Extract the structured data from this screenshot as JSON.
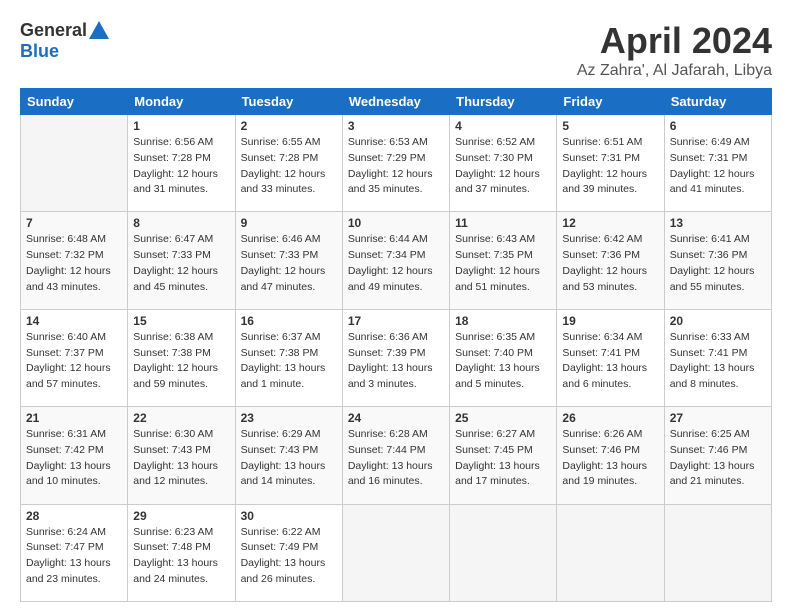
{
  "header": {
    "logo_general": "General",
    "logo_blue": "Blue",
    "title": "April 2024",
    "location": "Az Zahra', Al Jafarah, Libya"
  },
  "calendar": {
    "days_of_week": [
      "Sunday",
      "Monday",
      "Tuesday",
      "Wednesday",
      "Thursday",
      "Friday",
      "Saturday"
    ],
    "weeks": [
      [
        {
          "day": "",
          "sunrise": "",
          "sunset": "",
          "daylight": ""
        },
        {
          "day": "1",
          "sunrise": "Sunrise: 6:56 AM",
          "sunset": "Sunset: 7:28 PM",
          "daylight": "Daylight: 12 hours and 31 minutes."
        },
        {
          "day": "2",
          "sunrise": "Sunrise: 6:55 AM",
          "sunset": "Sunset: 7:28 PM",
          "daylight": "Daylight: 12 hours and 33 minutes."
        },
        {
          "day": "3",
          "sunrise": "Sunrise: 6:53 AM",
          "sunset": "Sunset: 7:29 PM",
          "daylight": "Daylight: 12 hours and 35 minutes."
        },
        {
          "day": "4",
          "sunrise": "Sunrise: 6:52 AM",
          "sunset": "Sunset: 7:30 PM",
          "daylight": "Daylight: 12 hours and 37 minutes."
        },
        {
          "day": "5",
          "sunrise": "Sunrise: 6:51 AM",
          "sunset": "Sunset: 7:31 PM",
          "daylight": "Daylight: 12 hours and 39 minutes."
        },
        {
          "day": "6",
          "sunrise": "Sunrise: 6:49 AM",
          "sunset": "Sunset: 7:31 PM",
          "daylight": "Daylight: 12 hours and 41 minutes."
        }
      ],
      [
        {
          "day": "7",
          "sunrise": "Sunrise: 6:48 AM",
          "sunset": "Sunset: 7:32 PM",
          "daylight": "Daylight: 12 hours and 43 minutes."
        },
        {
          "day": "8",
          "sunrise": "Sunrise: 6:47 AM",
          "sunset": "Sunset: 7:33 PM",
          "daylight": "Daylight: 12 hours and 45 minutes."
        },
        {
          "day": "9",
          "sunrise": "Sunrise: 6:46 AM",
          "sunset": "Sunset: 7:33 PM",
          "daylight": "Daylight: 12 hours and 47 minutes."
        },
        {
          "day": "10",
          "sunrise": "Sunrise: 6:44 AM",
          "sunset": "Sunset: 7:34 PM",
          "daylight": "Daylight: 12 hours and 49 minutes."
        },
        {
          "day": "11",
          "sunrise": "Sunrise: 6:43 AM",
          "sunset": "Sunset: 7:35 PM",
          "daylight": "Daylight: 12 hours and 51 minutes."
        },
        {
          "day": "12",
          "sunrise": "Sunrise: 6:42 AM",
          "sunset": "Sunset: 7:36 PM",
          "daylight": "Daylight: 12 hours and 53 minutes."
        },
        {
          "day": "13",
          "sunrise": "Sunrise: 6:41 AM",
          "sunset": "Sunset: 7:36 PM",
          "daylight": "Daylight: 12 hours and 55 minutes."
        }
      ],
      [
        {
          "day": "14",
          "sunrise": "Sunrise: 6:40 AM",
          "sunset": "Sunset: 7:37 PM",
          "daylight": "Daylight: 12 hours and 57 minutes."
        },
        {
          "day": "15",
          "sunrise": "Sunrise: 6:38 AM",
          "sunset": "Sunset: 7:38 PM",
          "daylight": "Daylight: 12 hours and 59 minutes."
        },
        {
          "day": "16",
          "sunrise": "Sunrise: 6:37 AM",
          "sunset": "Sunset: 7:38 PM",
          "daylight": "Daylight: 13 hours and 1 minute."
        },
        {
          "day": "17",
          "sunrise": "Sunrise: 6:36 AM",
          "sunset": "Sunset: 7:39 PM",
          "daylight": "Daylight: 13 hours and 3 minutes."
        },
        {
          "day": "18",
          "sunrise": "Sunrise: 6:35 AM",
          "sunset": "Sunset: 7:40 PM",
          "daylight": "Daylight: 13 hours and 5 minutes."
        },
        {
          "day": "19",
          "sunrise": "Sunrise: 6:34 AM",
          "sunset": "Sunset: 7:41 PM",
          "daylight": "Daylight: 13 hours and 6 minutes."
        },
        {
          "day": "20",
          "sunrise": "Sunrise: 6:33 AM",
          "sunset": "Sunset: 7:41 PM",
          "daylight": "Daylight: 13 hours and 8 minutes."
        }
      ],
      [
        {
          "day": "21",
          "sunrise": "Sunrise: 6:31 AM",
          "sunset": "Sunset: 7:42 PM",
          "daylight": "Daylight: 13 hours and 10 minutes."
        },
        {
          "day": "22",
          "sunrise": "Sunrise: 6:30 AM",
          "sunset": "Sunset: 7:43 PM",
          "daylight": "Daylight: 13 hours and 12 minutes."
        },
        {
          "day": "23",
          "sunrise": "Sunrise: 6:29 AM",
          "sunset": "Sunset: 7:43 PM",
          "daylight": "Daylight: 13 hours and 14 minutes."
        },
        {
          "day": "24",
          "sunrise": "Sunrise: 6:28 AM",
          "sunset": "Sunset: 7:44 PM",
          "daylight": "Daylight: 13 hours and 16 minutes."
        },
        {
          "day": "25",
          "sunrise": "Sunrise: 6:27 AM",
          "sunset": "Sunset: 7:45 PM",
          "daylight": "Daylight: 13 hours and 17 minutes."
        },
        {
          "day": "26",
          "sunrise": "Sunrise: 6:26 AM",
          "sunset": "Sunset: 7:46 PM",
          "daylight": "Daylight: 13 hours and 19 minutes."
        },
        {
          "day": "27",
          "sunrise": "Sunrise: 6:25 AM",
          "sunset": "Sunset: 7:46 PM",
          "daylight": "Daylight: 13 hours and 21 minutes."
        }
      ],
      [
        {
          "day": "28",
          "sunrise": "Sunrise: 6:24 AM",
          "sunset": "Sunset: 7:47 PM",
          "daylight": "Daylight: 13 hours and 23 minutes."
        },
        {
          "day": "29",
          "sunrise": "Sunrise: 6:23 AM",
          "sunset": "Sunset: 7:48 PM",
          "daylight": "Daylight: 13 hours and 24 minutes."
        },
        {
          "day": "30",
          "sunrise": "Sunrise: 6:22 AM",
          "sunset": "Sunset: 7:49 PM",
          "daylight": "Daylight: 13 hours and 26 minutes."
        },
        {
          "day": "",
          "sunrise": "",
          "sunset": "",
          "daylight": ""
        },
        {
          "day": "",
          "sunrise": "",
          "sunset": "",
          "daylight": ""
        },
        {
          "day": "",
          "sunrise": "",
          "sunset": "",
          "daylight": ""
        },
        {
          "day": "",
          "sunrise": "",
          "sunset": "",
          "daylight": ""
        }
      ]
    ]
  }
}
